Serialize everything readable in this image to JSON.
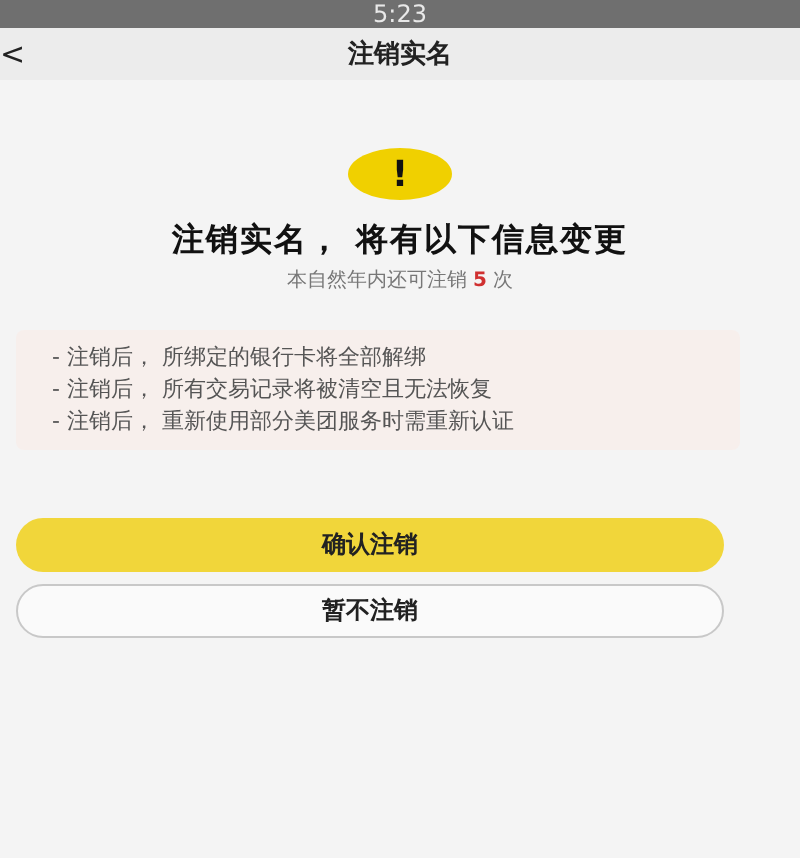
{
  "status_bar": {
    "time": "5:23"
  },
  "nav": {
    "back": "<",
    "title": "注销实名"
  },
  "warning": {
    "symbol": "!",
    "title": "注销实名， 将有以下信息变更",
    "subtitle": {
      "before": "本自然年内还可注销",
      "count": "5",
      "after": "次"
    }
  },
  "notes": [
    "- 注销后， 所绑定的银行卡将全部解绑",
    "- 注销后， 所有交易记录将被清空且无法恢复",
    "- 注销后， 重新使用部分美团服务时需重新认证"
  ],
  "buttons": [
    {
      "kind": "primary",
      "label": "确认注销"
    },
    {
      "kind": "secondary",
      "label": "暂不注销"
    }
  ]
}
